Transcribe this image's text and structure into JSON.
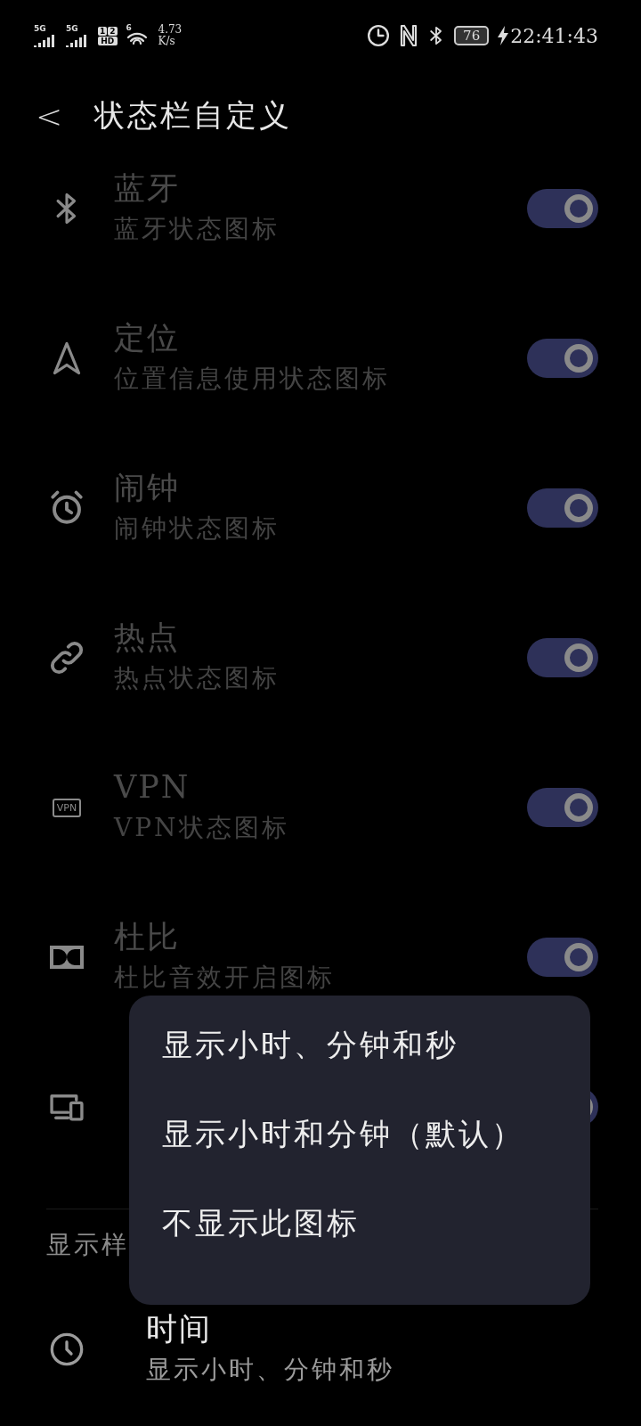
{
  "status_bar": {
    "signals": [
      {
        "label": "5G"
      },
      {
        "label": "5G"
      }
    ],
    "hd_labels": [
      "1",
      "2",
      "HD"
    ],
    "wifi_label": "6",
    "speed": [
      "4.73",
      "K/s"
    ],
    "battery": "76",
    "time": "22:41:43"
  },
  "header": {
    "back": "<",
    "title": "状态栏自定义"
  },
  "rows": [
    {
      "kind": "bluetooth",
      "title": "蓝牙",
      "subtitle": "蓝牙状态图标",
      "on": true
    },
    {
      "kind": "location",
      "title": "定位",
      "subtitle": "位置信息使用状态图标",
      "on": true
    },
    {
      "kind": "alarm",
      "title": "闹钟",
      "subtitle": "闹钟状态图标",
      "on": true
    },
    {
      "kind": "link",
      "title": "热点",
      "subtitle": "热点状态图标",
      "on": true
    },
    {
      "kind": "vpn",
      "icon_text": "VPN",
      "title": "VPN",
      "subtitle": "VPN状态图标",
      "on": true
    },
    {
      "kind": "dolby",
      "title": "杜比",
      "subtitle": "杜比音效开启图标",
      "on": true
    },
    {
      "kind": "devices",
      "on": true
    }
  ],
  "section": {
    "title": "显示样"
  },
  "time_row": {
    "title": "时间",
    "subtitle": "显示小时、分钟和秒"
  },
  "menu": {
    "items": [
      "显示小时、分钟和秒",
      "显示小时和分钟（默认）",
      "不显示此图标"
    ]
  }
}
